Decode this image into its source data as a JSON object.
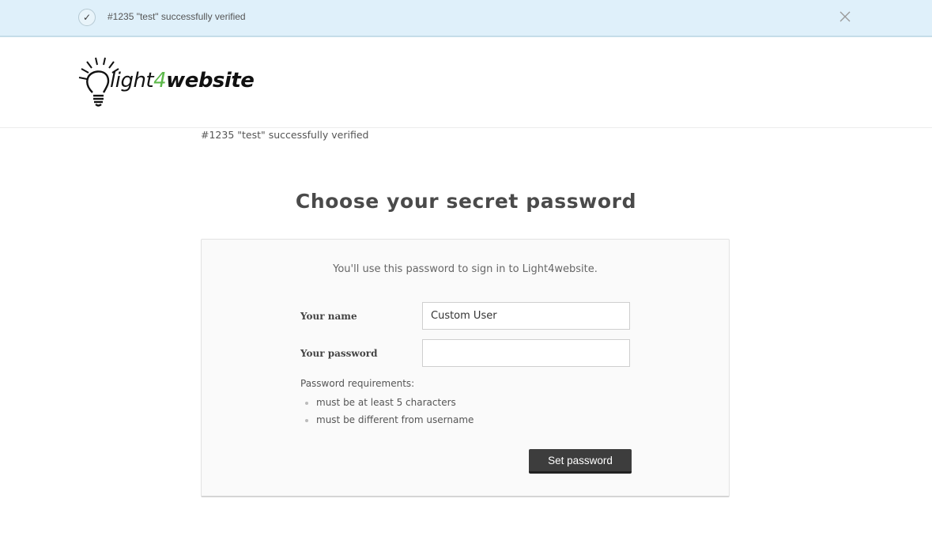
{
  "notification": {
    "message": "#1235 \"test\" successfully verified",
    "check_icon": "✓",
    "close_icon": "close-icon"
  },
  "header": {
    "logo": {
      "part1": "light",
      "part2": "4",
      "part3": "website",
      "accent_color": "#5cb84a"
    }
  },
  "verified_text": "#1235 \"test\" successfully verified",
  "title": "Choose your secret password",
  "panel": {
    "subtitle": "You'll use this password to sign in to Light4website.",
    "name_label": "Your name",
    "name_value": "Custom User",
    "password_label": "Your password",
    "password_value": "",
    "requirements_title": "Password requirements:",
    "requirements": [
      "must be at least 5 characters",
      "must be different from username"
    ],
    "submit_label": "Set password"
  },
  "colors": {
    "notice_bg": "#dff0fa",
    "button_bg": "#3d3d3d"
  }
}
